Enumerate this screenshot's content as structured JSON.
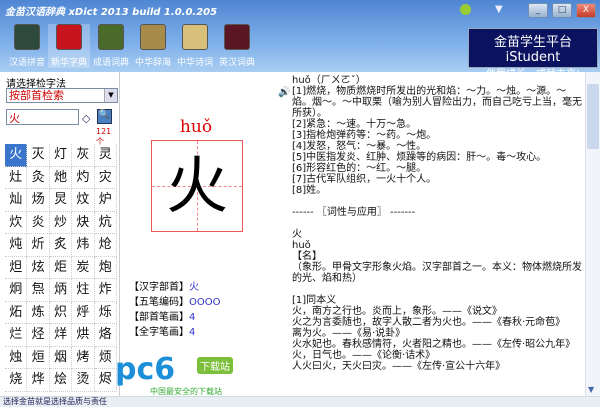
{
  "window": {
    "title": "金苗汉语辞典  xDict 2013  build 1.0.0.205",
    "minimize": "_",
    "maximize": "□",
    "close": "X"
  },
  "toolbar": [
    {
      "label": "汉语拼音",
      "color": "#2e4a3c"
    },
    {
      "label": "新华字典",
      "color": "#c8141c"
    },
    {
      "label": "成语词典",
      "color": "#4a6a2a"
    },
    {
      "label": "中华辞海",
      "color": "#a78b4b"
    },
    {
      "label": "中华诗词",
      "color": "#d9c07a"
    },
    {
      "label": "英汉词典",
      "color": "#5a1622"
    }
  ],
  "ad": {
    "line1": "金苗学生平台iStudent",
    "line2": "伴我成长，成就未来!"
  },
  "left": {
    "method_label": "请选择检字法",
    "method_value": "按部首检索",
    "query": "火",
    "count": "121个",
    "chars": [
      "火",
      "灭",
      "灯",
      "灰",
      "灵",
      "灶",
      "灸",
      "灺",
      "灼",
      "灾",
      "灿",
      "炀",
      "炅",
      "炆",
      "炉",
      "炊",
      "炎",
      "炒",
      "炔",
      "炕",
      "炖",
      "炘",
      "炙",
      "炜",
      "炝",
      "炟",
      "炫",
      "炬",
      "炭",
      "炮",
      "炯",
      "炰",
      "炳",
      "炷",
      "炸",
      "炻",
      "炼",
      "炽",
      "烀",
      "烁",
      "烂",
      "烃",
      "烊",
      "烘",
      "烙",
      "烛",
      "烜",
      "烟",
      "烤",
      "烦",
      "烧",
      "烨",
      "烩",
      "烫",
      "烬"
    ]
  },
  "mid": {
    "pinyin": "huǒ",
    "char": "火",
    "info": [
      {
        "label": "【汉字部首】",
        "value": "火"
      },
      {
        "label": "【五笔编码】",
        "value": "OOOO"
      },
      {
        "label": "【部首笔画】",
        "value": "4"
      },
      {
        "label": "【全字笔画】",
        "value": "4"
      }
    ]
  },
  "right": {
    "text": "huǒ（ㄏㄨㄛˇ）\n[1]燃烧，物质燃烧时所发出的光和焰：～力。～烛。～源。～焰。烟～。～中取栗（喻为别人冒险出力，而自己吃亏上当，毫无所获）。\n[2]紧急：～速。十万～急。\n[3]指枪炮弹药等：～药。～炮。\n[4]发怒，怒气：～暴。～性。\n[5]中医指发炎、红肿、烦躁等的病因：肝～。毒～攻心。\n[6]形容红色的：～红。～腿。\n[7]古代军队组织，一火十个人。\n[8]姓。\n\n------ 〖词性与应用〗 -------\n\n火\nhuǒ\n【名】\n（象形。甲骨文字形象火焰。汉字部首之一。本义：物体燃烧所发的光、焰和热）\n\n[1]同本义\n火，南方之行也。炎而上，象形。——《说文》\n火之为言委随也，故字人散二者为火也。——《春秋·元命苞》\n离为火。——《易·说卦》\n火水妃也。春秋感情符，火者阳之精也。——《左传·昭公九年》\n火，日气也。——《论衡·诘术》\n人火曰火，天火曰灾。——《左传·宣公十六年》"
  },
  "status": "选择金苗就是选择品质与责任",
  "watermark": {
    "logo": "pc6",
    "badge": "下载站",
    "sub": "中国最安全的下载站"
  }
}
